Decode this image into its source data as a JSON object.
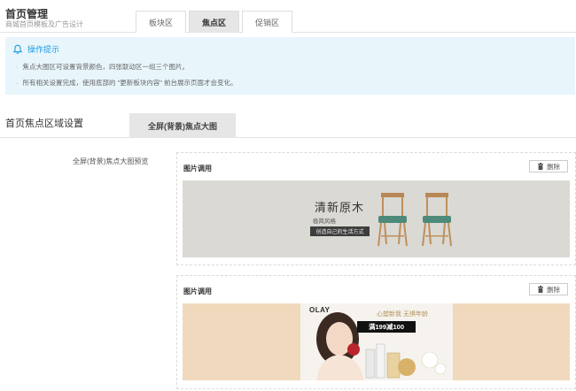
{
  "header": {
    "title": "首页管理",
    "subtitle": "商城首页模板及广告设计",
    "tabs": [
      {
        "label": "板块区",
        "active": false
      },
      {
        "label": "焦点区",
        "active": true
      },
      {
        "label": "促销区",
        "active": false
      }
    ]
  },
  "tips": {
    "title": "操作提示",
    "items": [
      "焦点大图区可设置背景颜色，四张联动区一组三个图片。",
      "所有相关设置完成，使用底部的 \"更新板块内容\" 前台展示页面才会变化。"
    ]
  },
  "section": {
    "title": "首页焦点区域设置",
    "tab_label": "全屏(背景)焦点大图",
    "preview_label": "全屏(背景)焦点大图预览"
  },
  "image_blocks": [
    {
      "heading": "图片调用",
      "delete_label": "删除",
      "background": "#dad9d4",
      "banner": {
        "title": "清新原木",
        "subtitle": "极简风格",
        "button": "创造自己的生活方式"
      }
    },
    {
      "heading": "图片调用",
      "delete_label": "删除",
      "background": "#f0d9bd",
      "banner": {
        "brand": "OLAY",
        "slogan": "心塑新我 无惧年龄",
        "promo": "满199减100"
      }
    }
  ],
  "colors": {
    "accent": "#1e9be1",
    "tips_bg": "#e8f6fc",
    "tab_active_bg": "#e6e6e6"
  },
  "icons": {
    "tips": "bell-icon",
    "delete": "trash-icon"
  }
}
